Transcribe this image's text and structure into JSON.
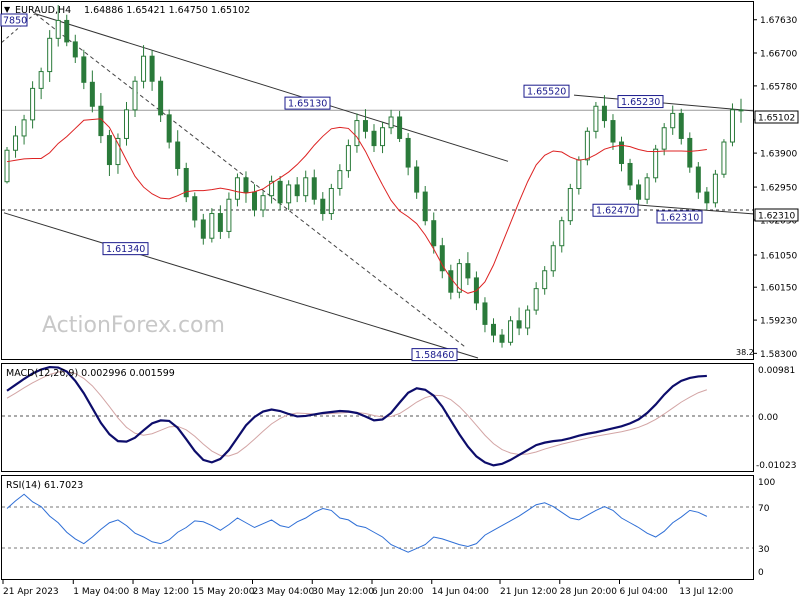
{
  "header": {
    "symbol_timeframe": "EURAUD,H4",
    "ohlc": "1.64886 1.65421 1.64750 1.65102",
    "dropdown_icon": "triangle-down-icon"
  },
  "watermark": "ActionForex.com",
  "colors": {
    "candle": "#2a7a3a",
    "ma": "#dd2222",
    "trendline": "#333333",
    "macd_main": "#0d0d6b",
    "macd_signal": "#d3a5a5",
    "rsi": "#2f6fd6",
    "label_border": "#1a1a8c"
  },
  "x_axis_labels": [
    "21 Apr 2023",
    "1 May 04:00",
    "8 May 12:00",
    "15 May 20:00",
    "23 May 04:00",
    "30 May 12:00",
    "6 Jun 20:00",
    "14 Jun 04:00",
    "21 Jun 12:00",
    "28 Jun 20:00",
    "6 Jul 04:00",
    "13 Jul 12:00"
  ],
  "price_labels": {
    "top_left": "7850",
    "low1": "1.61340",
    "high1": "1.65130",
    "low2": "1.58460",
    "high2": "1.65520",
    "high3": "1.65230",
    "low3": "1.62470",
    "low4": "1.62310",
    "fib": "38.2"
  },
  "price_tags": {
    "current": "1.65102",
    "support": "1.62310"
  },
  "macd": {
    "label": "MACD(12,26,9) 0.002996 0.001599",
    "ticks": [
      "0.00981",
      "0.00",
      "-0.01023"
    ]
  },
  "rsi": {
    "label": "RSI(14) 61.7023",
    "ticks": [
      "100",
      "70",
      "30",
      "0"
    ]
  },
  "chart_data": {
    "type": "candlestick",
    "price_axis": {
      "ticks": [
        "1.67630",
        "1.66700",
        "1.65780",
        "1.64830",
        "1.63900",
        "1.62950",
        "1.62030",
        "1.61050",
        "1.60150",
        "1.59230",
        "1.58300"
      ],
      "range": [
        1.5817,
        1.6807
      ]
    },
    "candles": [
      [
        1.631,
        1.6407,
        1.6305,
        1.6398
      ],
      [
        1.6398,
        1.6466,
        1.6377,
        1.6438
      ],
      [
        1.6438,
        1.6497,
        1.6414,
        1.6483
      ],
      [
        1.6483,
        1.6591,
        1.6459,
        1.6571
      ],
      [
        1.6571,
        1.6629,
        1.6541,
        1.6618
      ],
      [
        1.6618,
        1.6734,
        1.6589,
        1.6711
      ],
      [
        1.6711,
        1.6804,
        1.6688,
        1.6761
      ],
      [
        1.6761,
        1.6777,
        1.6689,
        1.6701
      ],
      [
        1.6701,
        1.6721,
        1.6642,
        1.6659
      ],
      [
        1.6659,
        1.6679,
        1.6569,
        1.6588
      ],
      [
        1.6588,
        1.6621,
        1.6504,
        1.6521
      ],
      [
        1.6521,
        1.6558,
        1.6418,
        1.6439
      ],
      [
        1.6439,
        1.6455,
        1.6326,
        1.6358
      ],
      [
        1.6358,
        1.6445,
        1.6332,
        1.6431
      ],
      [
        1.6431,
        1.6533,
        1.6411,
        1.6511
      ],
      [
        1.6511,
        1.6605,
        1.6491,
        1.6591
      ],
      [
        1.6591,
        1.6692,
        1.6571,
        1.6661
      ],
      [
        1.6661,
        1.6678,
        1.6564,
        1.6591
      ],
      [
        1.6591,
        1.6604,
        1.6477,
        1.6497
      ],
      [
        1.6497,
        1.6512,
        1.6403,
        1.6421
      ],
      [
        1.6421,
        1.6454,
        1.6327,
        1.6347
      ],
      [
        1.6347,
        1.6363,
        1.6253,
        1.6268
      ],
      [
        1.6268,
        1.628,
        1.6182,
        1.6203
      ],
      [
        1.6203,
        1.622,
        1.6134,
        1.6152
      ],
      [
        1.6152,
        1.6236,
        1.614,
        1.6221
      ],
      [
        1.6221,
        1.6244,
        1.615,
        1.6171
      ],
      [
        1.6171,
        1.628,
        1.6152,
        1.6261
      ],
      [
        1.6261,
        1.6333,
        1.6241,
        1.6321
      ],
      [
        1.6321,
        1.6339,
        1.6251,
        1.6281
      ],
      [
        1.6281,
        1.6303,
        1.6213,
        1.6231
      ],
      [
        1.6231,
        1.6283,
        1.6211,
        1.6271
      ],
      [
        1.6271,
        1.6327,
        1.6249,
        1.6311
      ],
      [
        1.6311,
        1.6326,
        1.623,
        1.6251
      ],
      [
        1.6251,
        1.6314,
        1.6231,
        1.6301
      ],
      [
        1.6301,
        1.6323,
        1.6253,
        1.6271
      ],
      [
        1.6271,
        1.6341,
        1.6253,
        1.6321
      ],
      [
        1.6321,
        1.6344,
        1.6246,
        1.6261
      ],
      [
        1.6261,
        1.6281,
        1.6201,
        1.6221
      ],
      [
        1.6221,
        1.6304,
        1.6203,
        1.6291
      ],
      [
        1.6291,
        1.6359,
        1.6271,
        1.6341
      ],
      [
        1.6341,
        1.6428,
        1.6321,
        1.6411
      ],
      [
        1.6411,
        1.6501,
        1.6391,
        1.6481
      ],
      [
        1.6481,
        1.6513,
        1.6431,
        1.6451
      ],
      [
        1.6451,
        1.6471,
        1.6393,
        1.6411
      ],
      [
        1.6411,
        1.6478,
        1.639,
        1.6461
      ],
      [
        1.6461,
        1.6511,
        1.6443,
        1.6491
      ],
      [
        1.6491,
        1.6508,
        1.6421,
        1.6431
      ],
      [
        1.6431,
        1.6446,
        1.6328,
        1.6351
      ],
      [
        1.6351,
        1.637,
        1.6262,
        1.6281
      ],
      [
        1.6281,
        1.6298,
        1.6188,
        1.6201
      ],
      [
        1.6201,
        1.6224,
        1.6109,
        1.6131
      ],
      [
        1.6131,
        1.6153,
        1.604,
        1.6061
      ],
      [
        1.6061,
        1.6078,
        1.5981,
        1.6001
      ],
      [
        1.6001,
        1.6094,
        1.5984,
        1.6081
      ],
      [
        1.6081,
        1.6113,
        1.6021,
        1.6041
      ],
      [
        1.6041,
        1.6059,
        1.5951,
        1.5971
      ],
      [
        1.5971,
        1.5987,
        1.5889,
        1.5911
      ],
      [
        1.5911,
        1.5928,
        1.5861,
        1.5881
      ],
      [
        1.5881,
        1.5898,
        1.5846,
        1.5861
      ],
      [
        1.5861,
        1.5934,
        1.5852,
        1.5921
      ],
      [
        1.5921,
        1.5958,
        1.5881,
        1.5901
      ],
      [
        1.5901,
        1.5964,
        1.5881,
        1.5951
      ],
      [
        1.5951,
        1.6029,
        1.5938,
        1.6011
      ],
      [
        1.6011,
        1.6074,
        1.5994,
        1.6061
      ],
      [
        1.6061,
        1.6143,
        1.6044,
        1.6131
      ],
      [
        1.6131,
        1.6212,
        1.6112,
        1.6201
      ],
      [
        1.6201,
        1.6304,
        1.6189,
        1.6291
      ],
      [
        1.6291,
        1.6381,
        1.6274,
        1.6371
      ],
      [
        1.6371,
        1.6462,
        1.6356,
        1.6451
      ],
      [
        1.6451,
        1.6533,
        1.6431,
        1.6521
      ],
      [
        1.6521,
        1.6552,
        1.6461,
        1.6481
      ],
      [
        1.6481,
        1.6499,
        1.6399,
        1.6421
      ],
      [
        1.6421,
        1.6436,
        1.6339,
        1.6361
      ],
      [
        1.6361,
        1.6374,
        1.6287,
        1.6301
      ],
      [
        1.6301,
        1.6316,
        1.6247,
        1.6261
      ],
      [
        1.6261,
        1.6334,
        1.6248,
        1.6321
      ],
      [
        1.6321,
        1.6413,
        1.6308,
        1.6401
      ],
      [
        1.6401,
        1.6474,
        1.6384,
        1.6461
      ],
      [
        1.6461,
        1.6523,
        1.6441,
        1.6501
      ],
      [
        1.6501,
        1.6514,
        1.6414,
        1.6431
      ],
      [
        1.6431,
        1.6448,
        1.6335,
        1.6351
      ],
      [
        1.6351,
        1.6365,
        1.6262,
        1.6281
      ],
      [
        1.6281,
        1.6295,
        1.6231,
        1.6251
      ],
      [
        1.6251,
        1.6343,
        1.6238,
        1.6331
      ],
      [
        1.6331,
        1.6429,
        1.6321,
        1.6421
      ],
      [
        1.6421,
        1.6529,
        1.6409,
        1.6511
      ],
      [
        1.6511,
        1.6542,
        1.6475,
        1.651
      ]
    ],
    "moving_average": [
      1.6366,
      1.637,
      1.6374,
      1.6375,
      1.6375,
      1.6391,
      1.6417,
      1.6436,
      1.6459,
      1.6482,
      1.6484,
      1.6486,
      1.6462,
      1.6417,
      1.637,
      1.6325,
      1.6295,
      1.6276,
      1.6264,
      1.6262,
      1.6271,
      1.6282,
      1.6285,
      1.6285,
      1.6288,
      1.6292,
      1.6288,
      1.6282,
      1.6278,
      1.6282,
      1.629,
      1.6306,
      1.6321,
      1.6337,
      1.6358,
      1.6383,
      1.6412,
      1.6437,
      1.6458,
      1.6462,
      1.6459,
      1.6435,
      1.6395,
      1.6347,
      1.6301,
      1.6258,
      1.6228,
      1.6212,
      1.6193,
      1.6161,
      1.6122,
      1.6077,
      1.604,
      1.6011,
      1.5998,
      1.6005,
      1.603,
      1.6077,
      1.6136,
      1.6195,
      1.6254,
      1.631,
      1.6357,
      1.6384,
      1.6396,
      1.6393,
      1.6379,
      1.637,
      1.6374,
      1.6386,
      1.6401,
      1.6408,
      1.6412,
      1.6408,
      1.64,
      1.6395,
      1.6394,
      1.6396,
      1.6396,
      1.6396,
      1.6395,
      1.6397,
      1.64
    ],
    "macd_main": [
      0.005,
      0.0062,
      0.0074,
      0.0085,
      0.0093,
      0.0098,
      0.0097,
      0.0089,
      0.007,
      0.0045,
      0.0015,
      -0.0015,
      -0.0038,
      -0.0052,
      -0.0053,
      -0.0045,
      -0.003,
      -0.0016,
      -0.001,
      -0.0011,
      -0.0025,
      -0.0048,
      -0.0072,
      -0.009,
      -0.0095,
      -0.0088,
      -0.007,
      -0.0045,
      -0.002,
      -0.0003,
      0.0008,
      0.0012,
      0.0009,
      0.0003,
      -0.0002,
      -0.0001,
      0.0002,
      0.0005,
      0.0007,
      0.0009,
      0.0008,
      0.0005,
      -0.0002,
      -0.001,
      -0.0008,
      0.0005,
      0.0026,
      0.0046,
      0.0055,
      0.0052,
      0.004,
      0.0018,
      -0.001,
      -0.0038,
      -0.0063,
      -0.0083,
      -0.0095,
      -0.0101,
      -0.0098,
      -0.009,
      -0.008,
      -0.007,
      -0.006,
      -0.0055,
      -0.0052,
      -0.005,
      -0.0046,
      -0.0041,
      -0.0037,
      -0.0034,
      -0.003,
      -0.0026,
      -0.0022,
      -0.0016,
      -0.0008,
      0.0005,
      0.0022,
      0.0042,
      0.0059,
      0.007,
      0.0076,
      0.0079,
      0.008
    ],
    "macd_signal": [
      0.0035,
      0.0045,
      0.0056,
      0.0066,
      0.0075,
      0.0083,
      0.0088,
      0.0089,
      0.0085,
      0.0075,
      0.006,
      0.004,
      0.0018,
      -0.0005,
      -0.0024,
      -0.0036,
      -0.004,
      -0.0037,
      -0.003,
      -0.0023,
      -0.0022,
      -0.0029,
      -0.0042,
      -0.0058,
      -0.0072,
      -0.0081,
      -0.0082,
      -0.0076,
      -0.0063,
      -0.0048,
      -0.0032,
      -0.0017,
      -0.0006,
      0.0002,
      0.0005,
      0.0004,
      0.0003,
      0.0003,
      0.0004,
      0.0005,
      0.0006,
      0.0006,
      0.0004,
      0.0,
      -0.0003,
      -0.0002,
      0.0004,
      0.0015,
      0.0027,
      0.0036,
      0.0041,
      0.004,
      0.0032,
      0.0018,
      0.0,
      -0.002,
      -0.004,
      -0.0057,
      -0.0069,
      -0.0076,
      -0.0079,
      -0.0078,
      -0.0074,
      -0.0068,
      -0.0063,
      -0.0058,
      -0.0054,
      -0.005,
      -0.0046,
      -0.0042,
      -0.0039,
      -0.0036,
      -0.0033,
      -0.0029,
      -0.0024,
      -0.0017,
      -0.0008,
      0.0003,
      0.0015,
      0.0027,
      0.0037,
      0.0046,
      0.0052
    ],
    "rsi": [
      70,
      78,
      85,
      77,
      72,
      62,
      55,
      45,
      38,
      33,
      40,
      48,
      55,
      58,
      52,
      44,
      40,
      35,
      33,
      37,
      45,
      50,
      57,
      56,
      52,
      47,
      53,
      60,
      55,
      50,
      54,
      58,
      52,
      50,
      56,
      60,
      66,
      70,
      68,
      60,
      58,
      52,
      50,
      45,
      40,
      32,
      28,
      24,
      28,
      32,
      40,
      38,
      35,
      32,
      30,
      33,
      42,
      47,
      52,
      57,
      62,
      68,
      74,
      76,
      72,
      66,
      60,
      58,
      63,
      68,
      72,
      68,
      60,
      55,
      50,
      44,
      40,
      46,
      55,
      61,
      68,
      66,
      61.7
    ],
    "macd_range": [
      -0.01023,
      0.00981
    ],
    "rsi_range": [
      0,
      100
    ],
    "rsi_levels": [
      70,
      30
    ],
    "annotations": [
      {
        "label": "1.61340",
        "price": 1.6134
      },
      {
        "label": "1.65130",
        "price": 1.6513
      },
      {
        "label": "1.58460",
        "price": 1.5846
      },
      {
        "label": "1.65520",
        "price": 1.6552
      },
      {
        "label": "1.65230",
        "price": 1.6523
      },
      {
        "label": "1.62470",
        "price": 1.6247
      },
      {
        "label": "1.62310",
        "price": 1.6231
      }
    ]
  }
}
